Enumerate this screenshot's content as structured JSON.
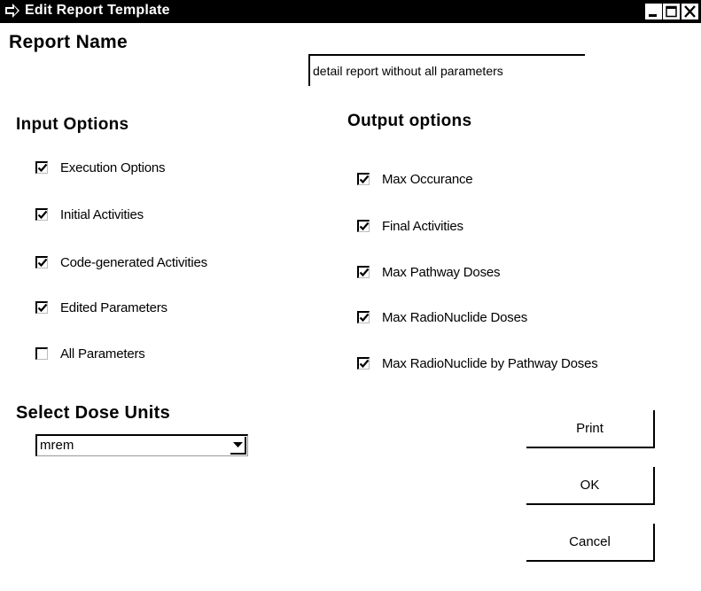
{
  "window": {
    "title": "Edit Report Template",
    "controls": {
      "minimize_icon": "minimize-icon",
      "maximize_icon": "maximize-icon",
      "close_icon": "close-icon"
    }
  },
  "report_name": {
    "label": "Report Name",
    "value": "detail report without all parameters"
  },
  "input_options": {
    "heading": "Input Options",
    "items": [
      {
        "label": "Execution Options",
        "checked": true
      },
      {
        "label": "Initial Activities",
        "checked": true
      },
      {
        "label": "Code-generated Activities",
        "checked": true
      },
      {
        "label": "Edited Parameters",
        "checked": true
      },
      {
        "label": "All Parameters",
        "checked": false
      }
    ]
  },
  "output_options": {
    "heading": "Output options",
    "items": [
      {
        "label": "Max Occurance",
        "checked": true
      },
      {
        "label": "Final Activities",
        "checked": true
      },
      {
        "label": "Max Pathway Doses",
        "checked": true
      },
      {
        "label": "Max RadioNuclide Doses",
        "checked": true
      },
      {
        "label": "Max RadioNuclide by Pathway Doses",
        "checked": true
      }
    ]
  },
  "dose_units": {
    "label": "Select Dose Units",
    "selected": "mrem"
  },
  "buttons": {
    "print": "Print",
    "ok": "OK",
    "cancel": "Cancel"
  }
}
